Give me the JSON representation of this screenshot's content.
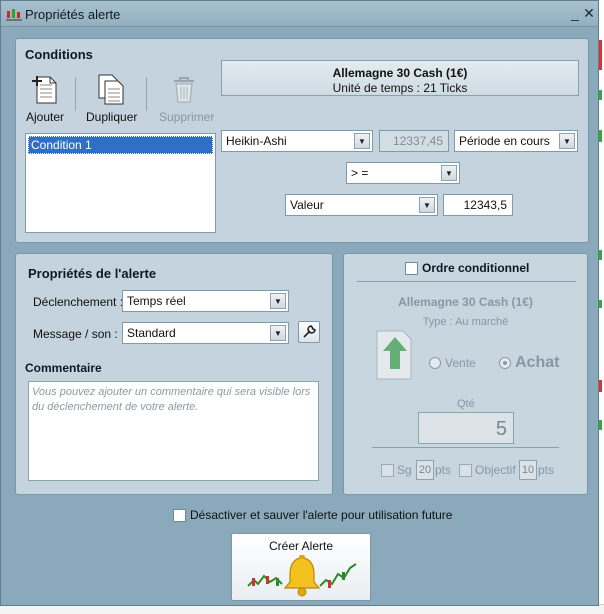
{
  "window": {
    "title": "Propriétés alerte",
    "minimize_glyph": "_",
    "close_glyph": "✕"
  },
  "conditions": {
    "heading": "Conditions",
    "toolbar": {
      "add_label": "Ajouter",
      "duplicate_label": "Dupliquer",
      "delete_label": "Supprimer"
    },
    "instrument": {
      "name": "Allemagne 30 Cash (1€)",
      "timeframe": "Unité de temps : 21 Ticks"
    },
    "list": [
      "Condition 1"
    ],
    "indicator": {
      "value": "Heikin-Ashi",
      "current_value": "12337,45",
      "period": "Période en cours"
    },
    "operator": "> =",
    "compare": {
      "type": "Valeur",
      "value": "12343,5"
    }
  },
  "properties": {
    "heading": "Propriétés de l'alerte",
    "trigger_label": "Déclenchement :",
    "trigger_value": "Temps réel",
    "sound_label": "Message / son :",
    "sound_value": "Standard",
    "comment_heading": "Commentaire",
    "comment_placeholder": "Vous pouvez ajouter un commentaire qui sera visible lors du déclenchement de votre alerte."
  },
  "order": {
    "heading": "Ordre conditionnel",
    "instrument": "Allemagne 30 Cash (1€)",
    "type_text": "Type : Au marché",
    "sell_label": "Vente",
    "buy_label": "Achat",
    "qty_label": "Qté",
    "qty_value": "5",
    "stop_label": "Sg",
    "stop_value": "20",
    "stop_unit": "pts",
    "target_label": "Objectif",
    "target_value": "10",
    "target_unit": "pts"
  },
  "footer": {
    "disable_label": "Désactiver et sauver l'alerte pour utilisation future",
    "create_label": "Créer Alerte"
  },
  "colors": {
    "window_bg": "#8aa9bb",
    "panel_bg": "#c4d3dd",
    "selection": "#2f6fc7"
  }
}
